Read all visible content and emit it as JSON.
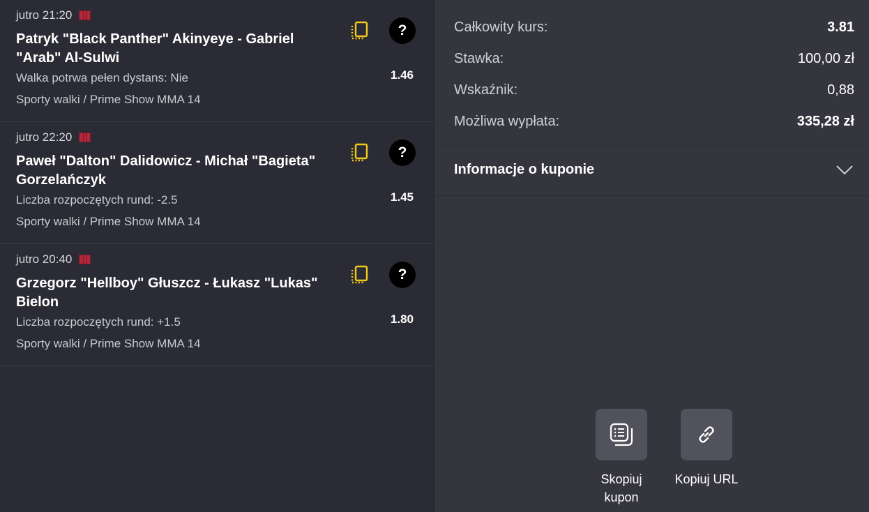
{
  "bets": [
    {
      "time": "jutro 21:20",
      "match": "Patryk \"Black Panther\" Akinyeye - Gabriel \"Arab\" Al-Sulwi",
      "market": "Walka potrwa pełen dystans: Nie",
      "odds": "1.46",
      "category": "Sporty walki / Prime Show MMA 14"
    },
    {
      "time": "jutro 22:20",
      "match": "Paweł \"Dalton\" Dalidowicz - Michał \"Bagieta\" Gorzelańczyk",
      "market": "Liczba rozpoczętych rund: -2.5",
      "odds": "1.45",
      "category": "Sporty walki / Prime Show MMA 14"
    },
    {
      "time": "jutro 20:40",
      "match": "Grzegorz \"Hellboy\" Głuszcz - Łukasz \"Lukas\" Bielon",
      "market": "Liczba rozpoczętych rund: +1.5",
      "odds": "1.80",
      "category": "Sporty walki / Prime Show MMA 14"
    }
  ],
  "help_glyph": "?",
  "summary": {
    "total_odds_label": "Całkowity kurs:",
    "total_odds_value": "3.81",
    "stake_label": "Stawka:",
    "stake_value": "100,00 zł",
    "indicator_label": "Wskaźnik:",
    "indicator_value": "0,88",
    "payout_label": "Możliwa wypłata:",
    "payout_value": "335,28 zł"
  },
  "info_section": {
    "title": "Informacje o kuponie"
  },
  "actions": {
    "copy_coupon_label": "Skopiuj\nkupon",
    "copy_url_label": "Kopiuj URL"
  },
  "colors": {
    "left_bg": "#2b2b35",
    "right_bg": "#35353e",
    "accent_yellow": "#f2c81b",
    "flag_red": "#b1283a",
    "action_btn_bg": "#52525c"
  },
  "icons": {
    "copy_bet": "copy-bet-icon",
    "help": "help-icon",
    "flag": "flag-icon",
    "chevron": "chevron-down-icon",
    "copy_coupon": "copy-coupon-icon",
    "link": "link-icon"
  }
}
